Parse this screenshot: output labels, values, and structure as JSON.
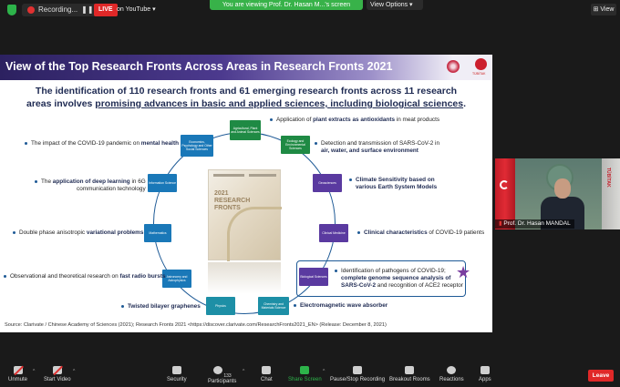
{
  "topbar": {
    "recording_label": "Recording...",
    "live_label": "LIVE",
    "youtube_label": "on YouTube",
    "viewing_banner": "You are viewing Prof. Dr. Hasan M...'s screen",
    "view_options_label": "View Options ▾",
    "view_button_label": "View"
  },
  "slide": {
    "title": "View of the Top Research Fronts Across Areas in Research Fronts 2021",
    "subtitle_part1": "The identification of 110 research fronts and 61 emerging research fronts across 11 research",
    "subtitle_part2": "areas involves ",
    "subtitle_underlined": "promising advances in basic and applied sciences, including biological sciences",
    "subtitle_end": ".",
    "logo_right_text": "TÜBİTAK",
    "book": {
      "year": "2021",
      "line1": "RESEARCH",
      "line2": "FRONTS"
    },
    "nodes": [
      {
        "id": "agricultural",
        "label": "Agricultural, Plant and Animal Sciences"
      },
      {
        "id": "ecology",
        "label": "Ecology and Environmental Sciences"
      },
      {
        "id": "geosciences",
        "label": "Geosciences"
      },
      {
        "id": "clinical",
        "label": "Clinical Medicine"
      },
      {
        "id": "biological",
        "label": "Biological Sciences"
      },
      {
        "id": "chemistry",
        "label": "Chemistry and Materials Science"
      },
      {
        "id": "physics",
        "label": "Physics"
      },
      {
        "id": "astronomy",
        "label": "Astronomy and Astrophysics"
      },
      {
        "id": "mathematics",
        "label": "Mathematics"
      },
      {
        "id": "information",
        "label": "Information Science"
      },
      {
        "id": "economics",
        "label": "Economics, Psychology and Other Social Sciences"
      }
    ],
    "labels": {
      "plant_pre": "Application of ",
      "plant_bold": "plant extracts as antioxidants",
      "plant_post": " in meat products",
      "sars_line1": "Detection and transmission of SARS-CoV-2 in",
      "sars_line2": "air, water, and surface environment",
      "climate_line1": "Climate Sensitivity based on",
      "climate_line2": "various Earth System Models",
      "clinical_bold": "Clinical characteristics",
      "clinical_post": " of COVID-19 patients",
      "path_line1": "Identification of pathogens of COVID-19;",
      "path_line2": "complete genome sequence analysis of",
      "path_line3_bold": "SARS-CoV-2",
      "path_line3_post": " and recognition of ACE2 receptor",
      "em_wave": "Electromagnetic wave absorber",
      "twisted": "Twisted bilayer graphenes",
      "radio_pre": "Observational and theoretical research on ",
      "radio_bold": "fast radio bursts",
      "variational_pre": "Double phase anisotropic ",
      "variational_bold": "variational problems",
      "deep_pre": "The ",
      "deep_bold": "application of deep learning",
      "deep_post": " in 6G",
      "deep_line2": "communication technology",
      "covid_pre": "The impact of the COVID-19 pandemic on ",
      "covid_bold": "mental health"
    },
    "source": "Source: Clarivate / Chinese Academy of Sciences (2021); Research Fronts 2021 <https://discover.clarivate.com/ResearchFronts2021_EN> (Release: December 8, 2021)"
  },
  "video": {
    "name": "Prof. Dr. Hasan MANDAL",
    "flag_text": "TÜBİTAK"
  },
  "toolbar": {
    "unmute": "Unmute",
    "start_video": "Start Video",
    "security": "Security",
    "participants": "Participants",
    "participants_count": "133",
    "chat": "Chat",
    "share_screen": "Share Screen",
    "pause_recording": "Pause/Stop Recording",
    "breakout": "Breakout Rooms",
    "reactions": "Reactions",
    "apps": "Apps",
    "leave": "Leave"
  },
  "colors": {
    "live_red": "#e02828",
    "zoom_green": "#2db34a",
    "slide_navy": "#1e2a52"
  }
}
